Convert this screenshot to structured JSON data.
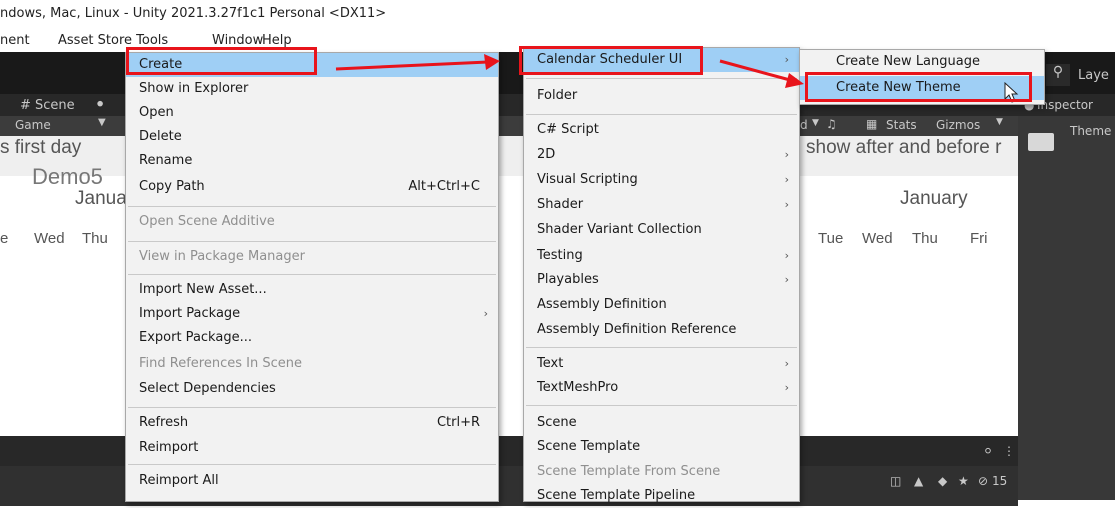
{
  "window": {
    "title": "ndows, Mac, Linux - Unity 2021.3.27f1c1 Personal <DX11>"
  },
  "menubar": {
    "items": [
      "nent",
      "Asset Store Tools",
      "Window",
      "Help"
    ]
  },
  "tabs": {
    "scene": "# Scene",
    "game": "Game",
    "inspector": "Inspector",
    "theme": "Theme",
    "layers": "Laye"
  },
  "gamebar": {
    "stats": "Stats",
    "gizmos": "Gizmos",
    "d": "d"
  },
  "game_view": {
    "left_text": "s first day",
    "right_text": "show after and before r",
    "partial": "Demo5",
    "month_left": "Janua",
    "month_right": "January",
    "days_left": [
      "e",
      "Wed",
      "Thu"
    ],
    "days_right": [
      "Tue",
      "Wed",
      "Thu",
      "Fri"
    ]
  },
  "bottom": {
    "count": "15"
  },
  "context_menu": {
    "items": [
      {
        "label": "Create",
        "arrow": false,
        "highlighted": true
      },
      {
        "label": "Show in Explorer"
      },
      {
        "label": "Open"
      },
      {
        "label": "Delete"
      },
      {
        "label": "Rename"
      },
      {
        "label": "Copy Path",
        "shortcut": "Alt+Ctrl+C"
      },
      {
        "label": "Open Scene Additive",
        "disabled": true
      },
      {
        "label": "View in Package Manager",
        "disabled": true
      },
      {
        "label": "Import New Asset..."
      },
      {
        "label": "Import Package",
        "arrow": true
      },
      {
        "label": "Export Package..."
      },
      {
        "label": "Find References In Scene",
        "disabled": true
      },
      {
        "label": "Select Dependencies"
      },
      {
        "label": "Refresh",
        "shortcut": "Ctrl+R"
      },
      {
        "label": "Reimport"
      },
      {
        "label": "Reimport All"
      }
    ]
  },
  "create_menu": {
    "items": [
      {
        "label": "Calendar Scheduler UI",
        "arrow": true,
        "highlighted": true
      },
      {
        "label": "Folder"
      },
      {
        "label": "C# Script"
      },
      {
        "label": "2D",
        "arrow": true
      },
      {
        "label": "Visual Scripting",
        "arrow": true
      },
      {
        "label": "Shader",
        "arrow": true
      },
      {
        "label": "Shader Variant Collection"
      },
      {
        "label": "Testing",
        "arrow": true
      },
      {
        "label": "Playables",
        "arrow": true
      },
      {
        "label": "Assembly Definition"
      },
      {
        "label": "Assembly Definition Reference"
      },
      {
        "label": "Text",
        "arrow": true
      },
      {
        "label": "TextMeshPro",
        "arrow": true
      },
      {
        "label": "Scene"
      },
      {
        "label": "Scene Template"
      },
      {
        "label": "Scene Template From Scene",
        "disabled": true
      },
      {
        "label": "Scene Template Pipeline"
      }
    ]
  },
  "calendar_menu": {
    "items": [
      {
        "label": "Create New Language"
      },
      {
        "label": "Create New Theme",
        "highlighted": true
      }
    ]
  },
  "colors": {
    "highlight": "#9fcff5",
    "annotation": "#e8141b",
    "menu_bg": "#f2f2f2"
  }
}
